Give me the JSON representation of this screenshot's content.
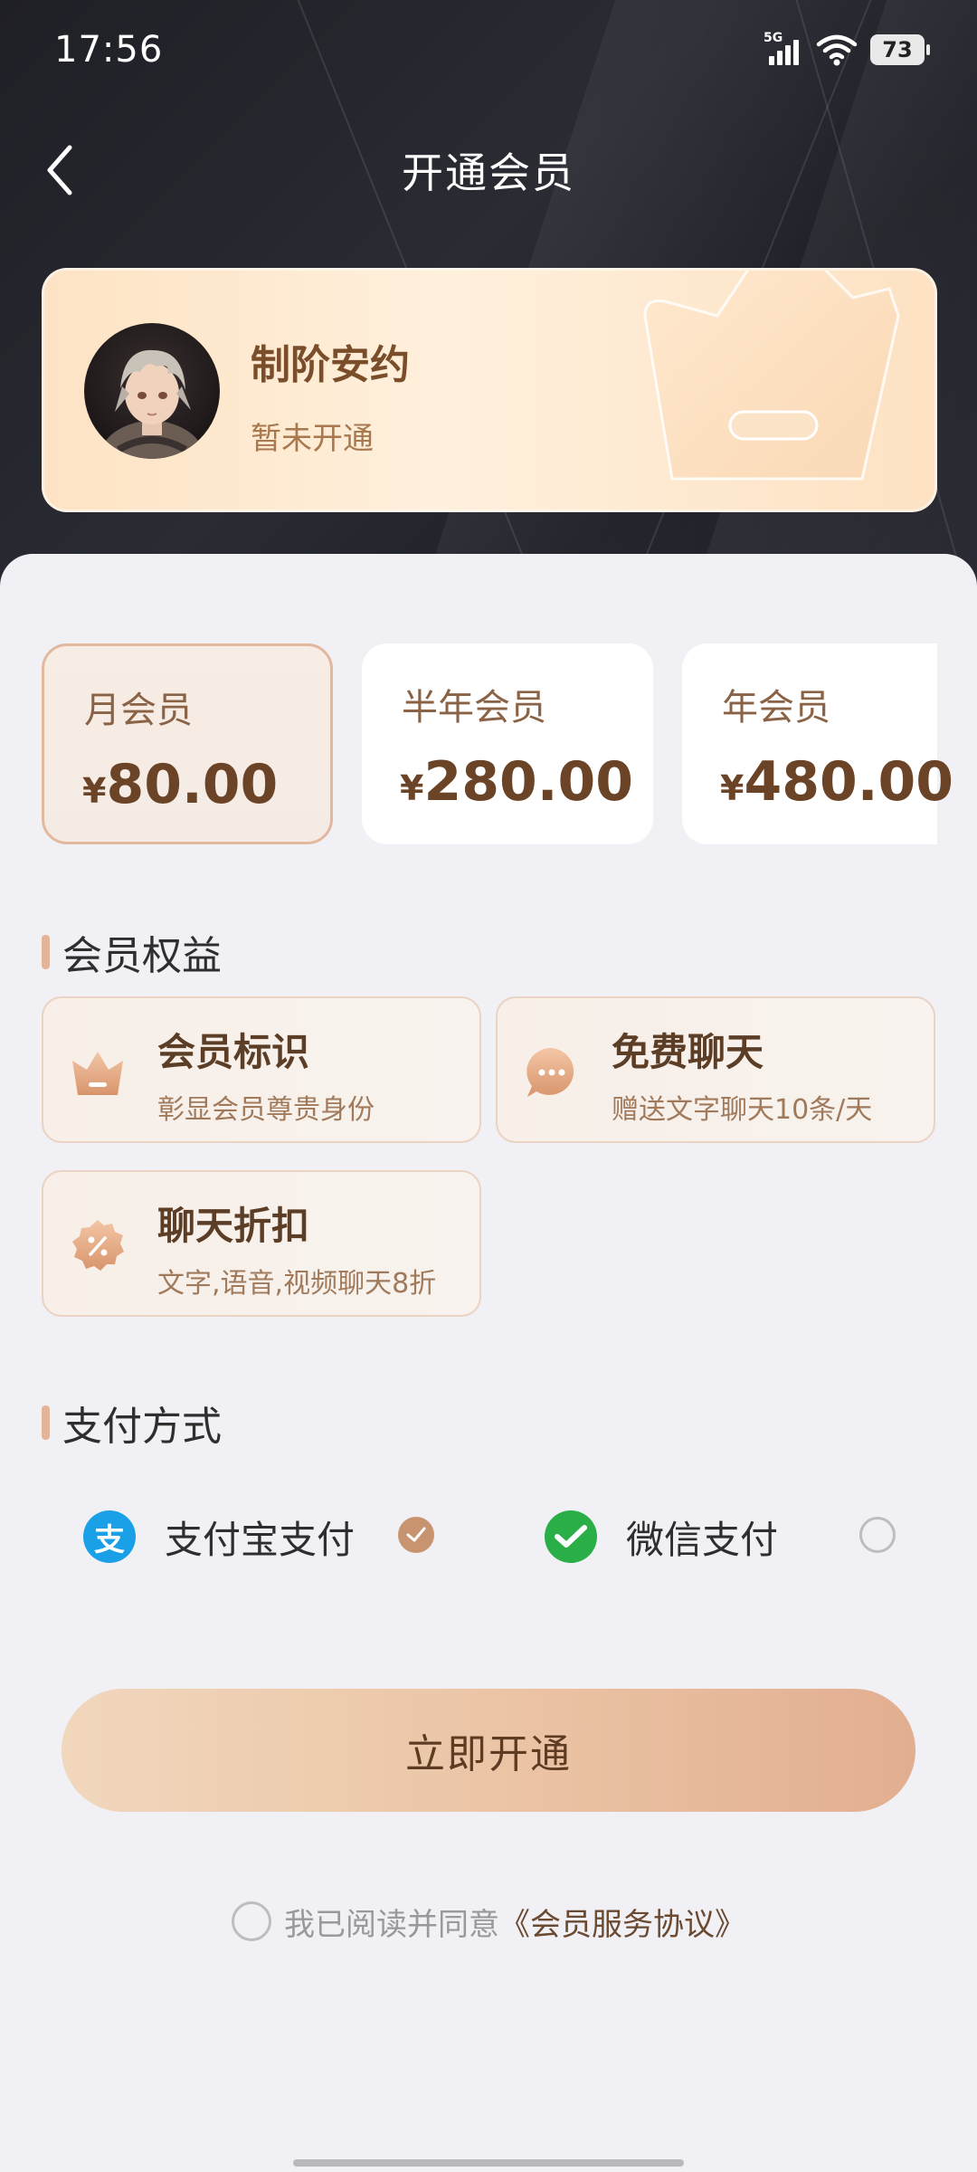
{
  "status_bar": {
    "time": "17:56",
    "network": "5G",
    "battery": "73"
  },
  "nav": {
    "title": "开通会员"
  },
  "profile": {
    "name": "制阶安约",
    "status": "暂未开通"
  },
  "plans": [
    {
      "name": "月会员",
      "currency": "¥",
      "price": "80.00",
      "selected": true
    },
    {
      "name": "半年会员",
      "currency": "¥",
      "price": "280.00",
      "selected": false
    },
    {
      "name": "年会员",
      "currency": "¥",
      "price": "480.00",
      "selected": false
    }
  ],
  "benefits_section": {
    "title": "会员权益",
    "items": [
      {
        "icon": "crown-icon",
        "title": "会员标识",
        "desc": "彰显会员尊贵身份"
      },
      {
        "icon": "chat-bubble-icon",
        "title": "免费聊天",
        "desc": "赠送文字聊天10条/天"
      },
      {
        "icon": "discount-badge-icon",
        "title": "聊天折扣",
        "desc": "文字,语音,视频聊天8折"
      }
    ]
  },
  "payment_section": {
    "title": "支付方式",
    "options": [
      {
        "icon": "alipay-icon",
        "label": "支付宝支付",
        "selected": true,
        "color": "#1aa0e6"
      },
      {
        "icon": "wechat-pay-icon",
        "label": "微信支付",
        "selected": false,
        "color": "#2aae48"
      }
    ]
  },
  "cta": {
    "label": "立即开通"
  },
  "agreement": {
    "prefix": "我已阅读并同意",
    "link": "《会员服务协议》",
    "checked": false
  },
  "colors": {
    "accent": "#c8936f",
    "price": "#6b4427",
    "hero_bg": "#1f2026"
  }
}
